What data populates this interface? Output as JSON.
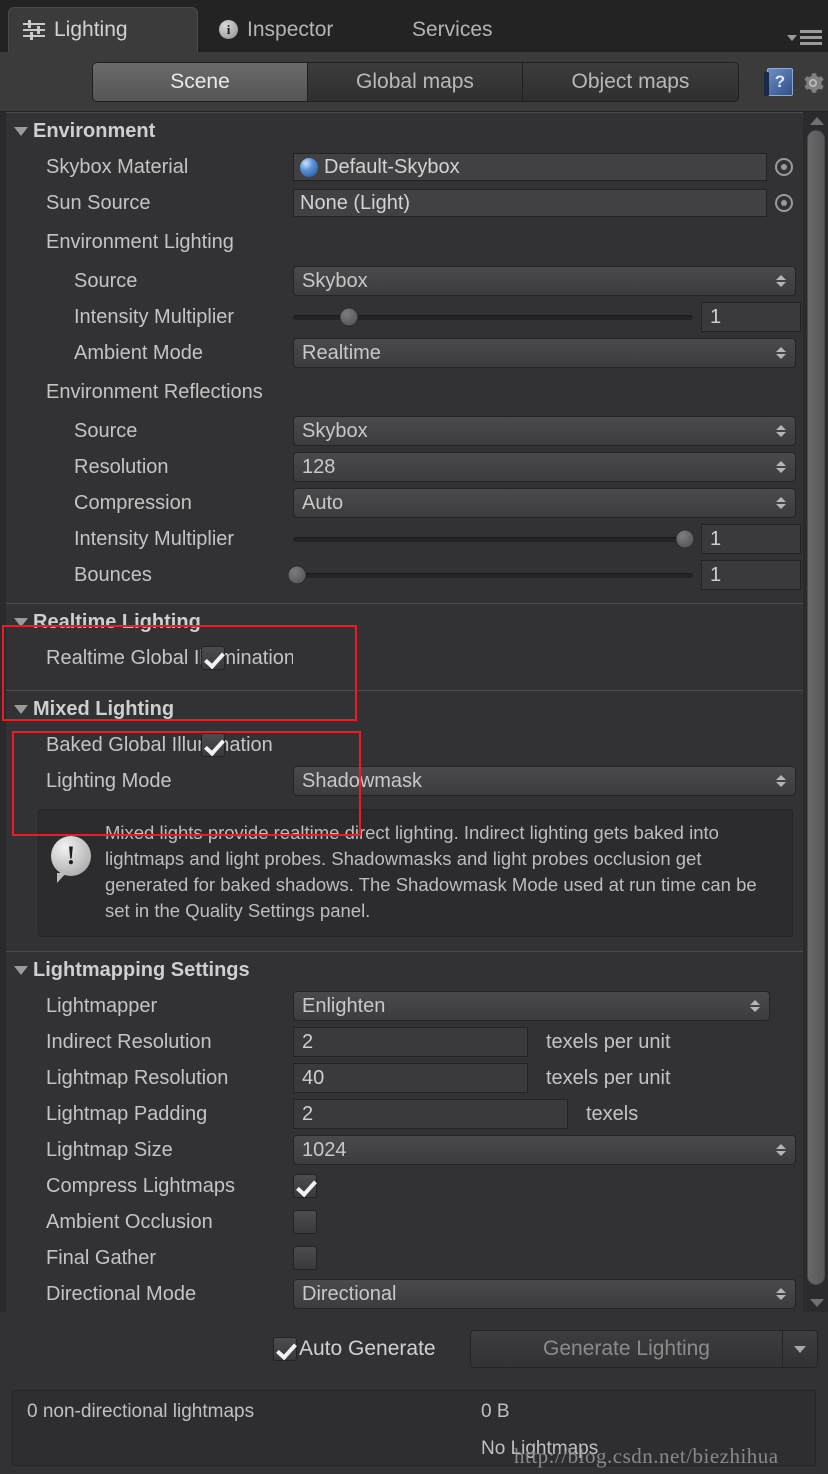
{
  "window": {
    "tabs": [
      {
        "label": "Lighting",
        "icon": "lighting-sliders-icon",
        "active": true
      },
      {
        "label": "Inspector",
        "icon": "info-circle-icon",
        "active": false
      },
      {
        "label": "Services",
        "icon": "",
        "active": false
      }
    ],
    "menu_icon": "hamburger-menu-icon"
  },
  "toolbar": {
    "segments": [
      {
        "label": "Scene",
        "active": true
      },
      {
        "label": "Global maps",
        "active": false
      },
      {
        "label": "Object maps",
        "active": false
      }
    ],
    "help_icon": "help-book-icon",
    "settings_icon": "gear-icon"
  },
  "environment": {
    "title": "Environment",
    "skybox_material": {
      "label": "Skybox Material",
      "value": "Default-Skybox",
      "picker": "object-picker-icon"
    },
    "sun_source": {
      "label": "Sun Source",
      "value": "None (Light)",
      "picker": "object-picker-icon"
    },
    "lighting_group": {
      "heading": "Environment Lighting",
      "source": {
        "label": "Source",
        "value": "Skybox"
      },
      "intensity": {
        "label": "Intensity Multiplier",
        "value": "1",
        "slider_percent": 14
      },
      "ambient_mode": {
        "label": "Ambient Mode",
        "value": "Realtime"
      }
    },
    "reflections_group": {
      "heading": "Environment Reflections",
      "source": {
        "label": "Source",
        "value": "Skybox"
      },
      "resolution": {
        "label": "Resolution",
        "value": "128"
      },
      "compression": {
        "label": "Compression",
        "value": "Auto"
      },
      "intensity": {
        "label": "Intensity Multiplier",
        "value": "1",
        "slider_percent": 98
      },
      "bounces": {
        "label": "Bounces",
        "value": "1",
        "slider_percent": 1
      }
    }
  },
  "realtime_lighting": {
    "title": "Realtime Lighting",
    "realtime_gi": {
      "label": "Realtime Global Illumination",
      "checked": true
    }
  },
  "mixed_lighting": {
    "title": "Mixed Lighting",
    "baked_gi": {
      "label": "Baked Global Illumination",
      "checked": true
    },
    "lighting_mode": {
      "label": "Lighting Mode",
      "value": "Shadowmask"
    },
    "help": {
      "icon": "info-balloon-icon",
      "text": "Mixed lights provide realtime direct lighting. Indirect lighting gets baked into lightmaps and light probes. Shadowmasks and light probes occlusion get generated for baked shadows. The Shadowmask Mode used at run time can be set in the Quality Settings panel."
    }
  },
  "lightmapping": {
    "title": "Lightmapping Settings",
    "lightmapper": {
      "label": "Lightmapper",
      "value": "Enlighten"
    },
    "indirect_resolution": {
      "label": "Indirect Resolution",
      "value": "2",
      "unit": "texels per unit"
    },
    "lightmap_resolution": {
      "label": "Lightmap Resolution",
      "value": "40",
      "unit": "texels per unit"
    },
    "lightmap_padding": {
      "label": "Lightmap Padding",
      "value": "2",
      "unit": "texels"
    },
    "lightmap_size": {
      "label": "Lightmap Size",
      "value": "1024"
    },
    "compress_lightmaps": {
      "label": "Compress Lightmaps",
      "checked": true
    },
    "ambient_occlusion": {
      "label": "Ambient Occlusion",
      "checked": false
    },
    "final_gather": {
      "label": "Final Gather",
      "checked": false
    },
    "directional_mode": {
      "label": "Directional Mode",
      "value": "Directional"
    }
  },
  "footer": {
    "auto_generate": {
      "label": "Auto Generate",
      "checked": true
    },
    "generate_button": {
      "label": "Generate Lighting",
      "dropdown_icon": "caret-down-icon"
    },
    "status": {
      "lightmaps_count": "0 non-directional lightmaps",
      "size": "0 B",
      "state": "No Lightmaps"
    }
  },
  "watermark": {
    "text": "http://blog.csdn.net/biezhihua"
  },
  "colors": {
    "panel_bg": "#323234",
    "tabbar_bg": "#232323",
    "highlight": "#ec1c24",
    "accent_blue": "#5b93d8"
  }
}
